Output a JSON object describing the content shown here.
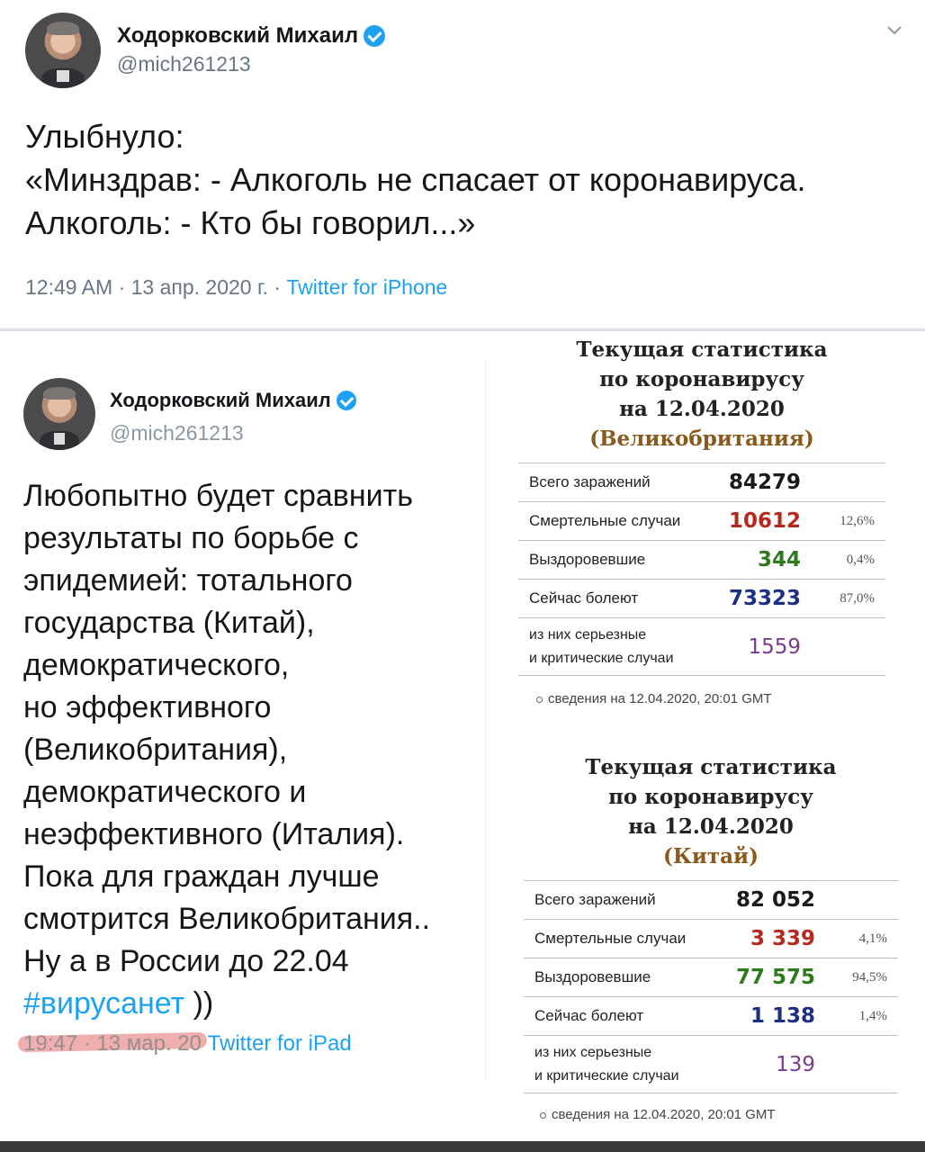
{
  "top_tweet": {
    "name": "Ходорковский Михаил",
    "handle": "@mich261213",
    "lines": [
      "Улыбнуло:",
      "«Минздрав: - Алкоголь не спасает от коронавируса.",
      "Алкоголь: - Кто бы говорил...»"
    ],
    "time": "12:49 AM · 13 апр. 2020 г. · ",
    "source": "Twitter for iPhone"
  },
  "left_tweet": {
    "name": "Ходорковский Михаил",
    "handle": "@mich261213",
    "lines": [
      "Любопытно будет сравнить",
      "результаты по борьбе с",
      "эпидемией: тотального",
      "государства (Китай),",
      "демократического,",
      "но эффективного",
      "(Великобритания),",
      "демократического и",
      "неэффективного (Италия).",
      "Пока для граждан лучше",
      "смотрится Великобритания..",
      "Ну а в России до 22.04"
    ],
    "hashtag": "#вирусанет",
    "after_hashtag": " ))",
    "time": "19:47 · 13 мар. 20",
    "source": " Twitter for iPad"
  },
  "stats_uk": {
    "title_lines": [
      "Текущая статистика",
      "по коронавирусу",
      "на 12.04.2020"
    ],
    "country": "(Великобритания)",
    "rows": [
      {
        "label": "Всего заражений",
        "value": "84279",
        "pct": ""
      },
      {
        "label": "Смертельные случаи",
        "value": "10612",
        "pct": "12,6%"
      },
      {
        "label": "Выздоровевшие",
        "value": "344",
        "pct": "0,4%"
      },
      {
        "label": "Сейчас болеют",
        "value": "73323",
        "pct": "87,0%"
      },
      {
        "label": "из них серьезные",
        "label2": "и критические случаи",
        "value": "1559",
        "pct": ""
      }
    ],
    "source": "сведения на 12.04.2020, 20:01 GMT"
  },
  "stats_china": {
    "title_lines": [
      "Текущая статистика",
      "по коронавирусу",
      "на 12.04.2020"
    ],
    "country": "(Китай)",
    "rows": [
      {
        "label": "Всего заражений",
        "value": "82 052",
        "pct": ""
      },
      {
        "label": "Смертельные случаи",
        "value": "3 339",
        "pct": "4,1%"
      },
      {
        "label": "Выздоровевшие",
        "value": "77 575",
        "pct": "94,5%"
      },
      {
        "label": "Сейчас болеют",
        "value": "1 138",
        "pct": "1,4%"
      },
      {
        "label": "из них серьезные",
        "label2": "и критические случаи",
        "value": "139",
        "pct": ""
      }
    ],
    "source": "сведения на 12.04.2020, 20:01 GMT"
  },
  "colors": {
    "accent": "#1da1f2",
    "deaths": "#b52a1e",
    "recovered": "#2f7a1e",
    "active": "#1c2f83",
    "critical": "#7b3a8f",
    "strike_highlight": "#e26e6e"
  },
  "icons": [
    "verified-badge-icon",
    "chevron-down-icon"
  ]
}
